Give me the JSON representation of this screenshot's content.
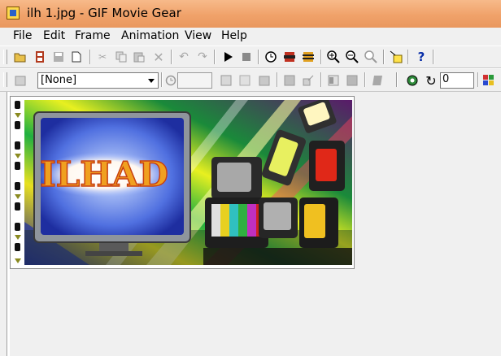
{
  "window": {
    "title": "ilh 1.jpg - GIF Movie Gear"
  },
  "menu": [
    "File",
    "Edit",
    "Frame",
    "Animation",
    "View",
    "Help"
  ],
  "toolbar2": {
    "palette_select": "[None]",
    "frame_counter": "0"
  },
  "image": {
    "caption": "ILHAD"
  }
}
